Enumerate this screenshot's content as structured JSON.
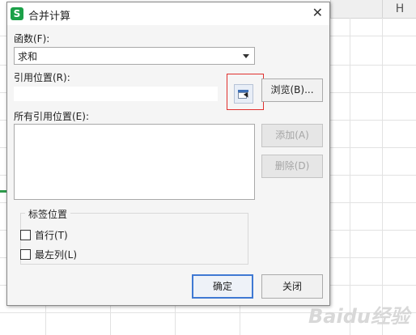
{
  "sheet": {
    "column_h": "H",
    "watermark": "Baidu经验"
  },
  "dialog": {
    "title": "合并计算",
    "app_icon_letter": "S",
    "close_glyph": "✕",
    "function_label": "函数(F):",
    "function_value": "求和",
    "ref_label": "引用位置(R):",
    "ref_value": "",
    "browse_label": "浏览(B)...",
    "all_refs_label": "所有引用位置(E):",
    "add_label": "添加(A)",
    "delete_label": "删除(D)",
    "label_group_title": "标签位置",
    "first_row_label": "首行(T)",
    "first_row_checked": false,
    "left_col_label": "最左列(L)",
    "left_col_checked": false,
    "ok_label": "确定",
    "close_label": "关闭"
  },
  "colors": {
    "accent": "#3f79d3",
    "highlight": "#e0302e",
    "app_icon": "#1ba048"
  }
}
